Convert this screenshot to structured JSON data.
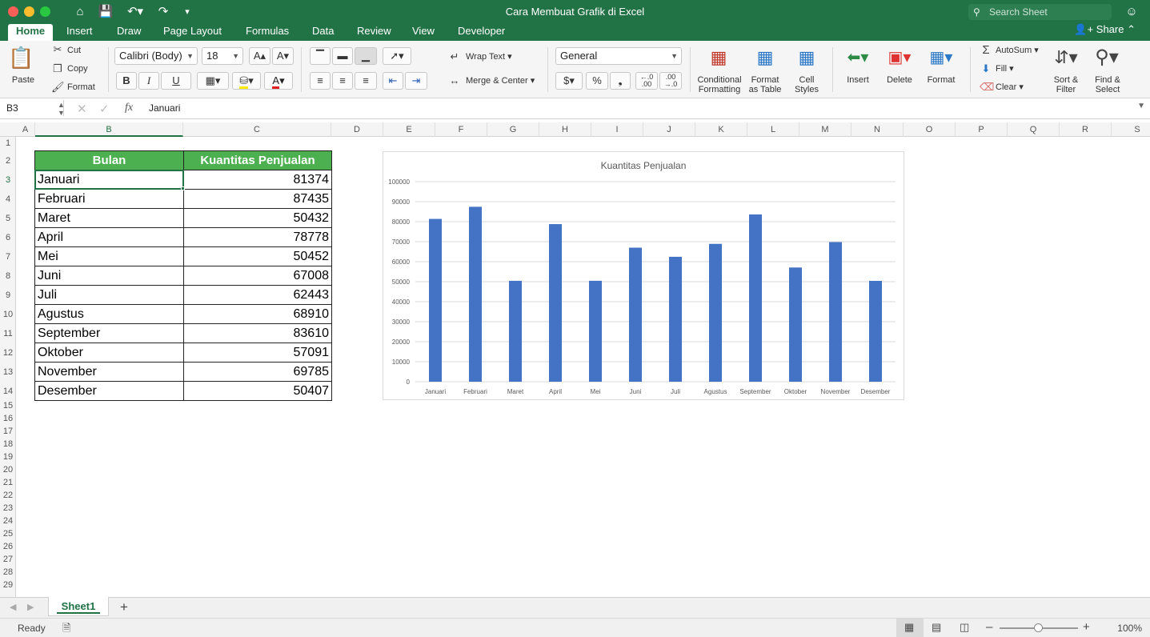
{
  "window": {
    "title": "Cara Membuat Grafik di Excel",
    "search_placeholder": "Search Sheet"
  },
  "tabs": [
    "Home",
    "Insert",
    "Draw",
    "Page Layout",
    "Formulas",
    "Data",
    "Review",
    "View",
    "Developer"
  ],
  "share_label": "Share",
  "ribbon": {
    "paste": "Paste",
    "cut": "Cut",
    "copy": "Copy",
    "format_painter": "Format",
    "font_name": "Calibri (Body)",
    "font_size": "18",
    "bold": "B",
    "italic": "I",
    "underline": "U",
    "wrap_text": "Wrap Text",
    "merge_center": "Merge & Center",
    "number_format": "General",
    "currency": "$",
    "percent": "%",
    "comma": "❟",
    "conditional_formatting_1": "Conditional",
    "conditional_formatting_2": "Formatting",
    "format_as_table_1": "Format",
    "format_as_table_2": "as Table",
    "cell_styles_1": "Cell",
    "cell_styles_2": "Styles",
    "insert": "Insert",
    "delete": "Delete",
    "format": "Format",
    "autosum": "AutoSum",
    "fill": "Fill",
    "clear": "Clear",
    "sort_filter_1": "Sort &",
    "sort_filter_2": "Filter",
    "find_select_1": "Find &",
    "find_select_2": "Select"
  },
  "formula_bar": {
    "name_box": "B3",
    "fx": "fx",
    "content": "Januari"
  },
  "columns": [
    "A",
    "B",
    "C",
    "D",
    "E",
    "F",
    "G",
    "H",
    "I",
    "J",
    "K",
    "L",
    "M",
    "N",
    "O",
    "P",
    "Q",
    "R",
    "S"
  ],
  "rows": [
    "1",
    "2",
    "3",
    "4",
    "5",
    "6",
    "7",
    "8",
    "9",
    "10",
    "11",
    "12",
    "13",
    "14",
    "15",
    "16",
    "17",
    "18",
    "19",
    "20",
    "21",
    "22",
    "23",
    "24",
    "25",
    "26",
    "27",
    "28",
    "29"
  ],
  "table": {
    "headers": [
      "Bulan",
      "Kuantitas Penjualan"
    ],
    "rows": [
      [
        "Januari",
        "81374"
      ],
      [
        "Februari",
        "87435"
      ],
      [
        "Maret",
        "50432"
      ],
      [
        "April",
        "78778"
      ],
      [
        "Mei",
        "50452"
      ],
      [
        "Juni",
        "67008"
      ],
      [
        "Juli",
        "62443"
      ],
      [
        "Agustus",
        "68910"
      ],
      [
        "September",
        "83610"
      ],
      [
        "Oktober",
        "57091"
      ],
      [
        "November",
        "69785"
      ],
      [
        "Desember",
        "50407"
      ]
    ]
  },
  "chart_data": {
    "type": "bar",
    "title": "Kuantitas Penjualan",
    "categories": [
      "Januari",
      "Februari",
      "Maret",
      "April",
      "Mei",
      "Juni",
      "Juli",
      "Agustus",
      "September",
      "Oktober",
      "November",
      "Desember"
    ],
    "values": [
      81374,
      87435,
      50432,
      78778,
      50452,
      67008,
      62443,
      68910,
      83610,
      57091,
      69785,
      50407
    ],
    "ylim": [
      0,
      100000
    ],
    "yticks": [
      "0",
      "10000",
      "20000",
      "30000",
      "40000",
      "50000",
      "60000",
      "70000",
      "80000",
      "90000",
      "100000"
    ],
    "grid": true,
    "bar_color": "#4472c4"
  },
  "sheets": [
    "Sheet1"
  ],
  "status": {
    "ready": "Ready",
    "zoom": "100%"
  },
  "colors": {
    "excel_green": "#217346",
    "header_fill": "#4caf50"
  }
}
